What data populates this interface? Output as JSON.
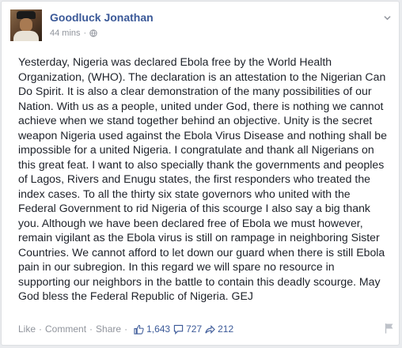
{
  "post": {
    "author": "Goodluck Jonathan",
    "timestamp": "44 mins",
    "separator_dot": "·",
    "body": "Yesterday, Nigeria was declared Ebola free by the World Health Organization, (WHO). The declaration is an attestation to the Nigerian Can Do Spirit. It is also a clear demonstration of the many possibilities of our Nation. With us as a people, united under God, there is nothing we cannot achieve when we stand together behind an objective. Unity is the secret weapon Nigeria used against the Ebola Virus Disease and nothing shall be impossible for a united Nigeria. I congratulate and thank all Nigerians on this great feat. I want to also specially thank the governments and peoples of Lagos, Rivers and Enugu states, the first responders who treated the index cases. To all the thirty six state governors who united with the Federal Government to rid Nigeria of this scourge I also say a big thank you. Although we have been declared free of Ebola we must however, remain vigilant as the Ebola virus is still on rampage in neighboring Sister Countries. We cannot afford to let down our guard when there is still Ebola pain in our subregion. In this regard we will spare no resource in supporting our neighbors in the battle to contain this deadly scourge. May God bless the Federal Republic of Nigeria. GEJ"
  },
  "footer": {
    "like_label": "Like",
    "comment_label": "Comment",
    "share_label": "Share",
    "separator": "·",
    "likes_count": "1,643",
    "comments_count": "727",
    "shares_count": "212"
  },
  "icons": {
    "audience": "globe-icon",
    "options": "chevron-down-icon",
    "likes": "thumbs-up-icon",
    "comments": "comment-icon",
    "shares": "share-arrow-icon",
    "report": "flag-icon"
  },
  "colors": {
    "link_blue": "#3b5998",
    "meta_gray": "#90949c",
    "text": "#1d2129",
    "card_border": "#dddfe2",
    "background": "#e9ebee"
  }
}
